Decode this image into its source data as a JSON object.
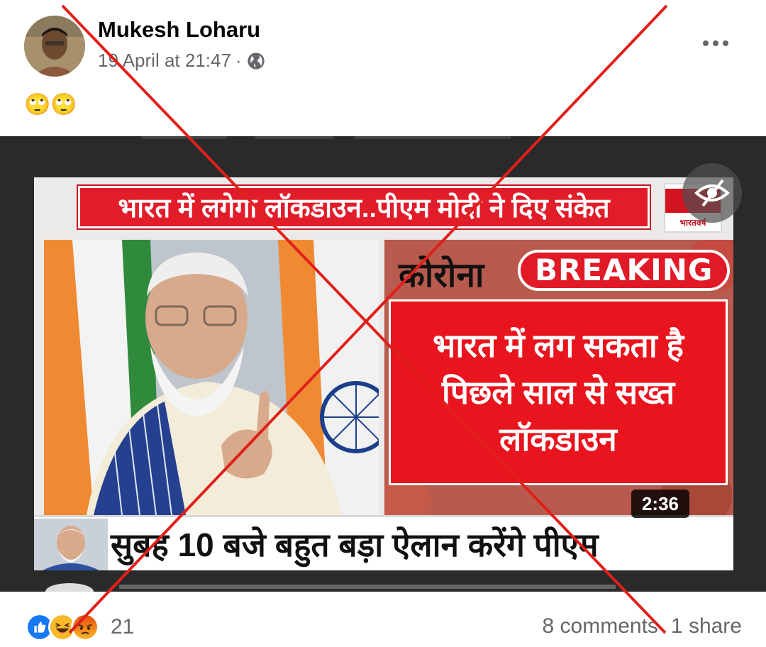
{
  "post": {
    "author": "Mukesh Loharu",
    "timestamp": "19 April at 21:47",
    "separator": "·",
    "privacy_icon": "globe-icon",
    "text": "🙄🙄",
    "more_icon": "more-horizontal-icon"
  },
  "media": {
    "headline": "भारत  में लगेगा लॉकडाउन..पीएम मोदी ने दिए संकेत",
    "channel_tag": "भारतवर्ष",
    "corona_label": "कोरोना",
    "breaking_label": "BREAKING",
    "breaking_lines": [
      "भारत में लग सकता है",
      "पिछले साल से सख्त",
      "लॉकडाउन"
    ],
    "ticker": "सुबह 10 बजे बहुत बड़ा ऐलान करेंगे पीएम",
    "duration": "2:36",
    "hide_icon": "eye-slash-icon"
  },
  "footer": {
    "reactions": [
      "like",
      "haha",
      "angry"
    ],
    "reaction_count": "21",
    "comments": "8 comments",
    "shares": "1 share"
  },
  "colors": {
    "news_red": "#e11d2a",
    "cross_red": "#e0201c",
    "like_blue": "#1877f2",
    "haha_yellow": "#f7b928",
    "angry_orange": "#e9710f"
  }
}
